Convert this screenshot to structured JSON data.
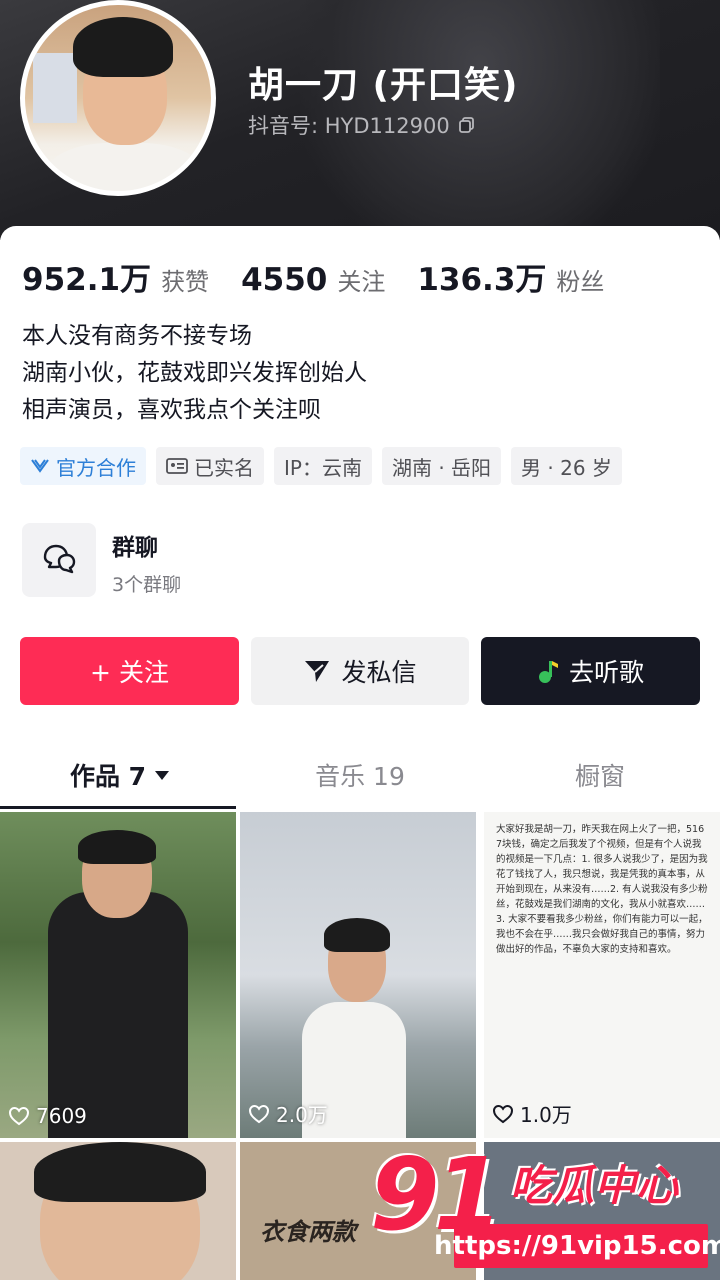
{
  "profile": {
    "nickname": "胡一刀 (开口笑)",
    "douyin_id": "抖音号: HYD112900"
  },
  "stats": [
    {
      "value": "952.1万",
      "label": "获赞"
    },
    {
      "value": "4550",
      "label": "关注"
    },
    {
      "value": "136.3万",
      "label": "粉丝"
    }
  ],
  "bio": [
    "本人没有商务不接专场",
    "湖南小伙，花鼓戏即兴发挥创始人",
    "相声演员，喜欢我点个关注呗"
  ],
  "tags": [
    {
      "label": "官方合作",
      "icon": "official-cooperation-icon"
    },
    {
      "label": "已实名",
      "icon": "id-card-icon"
    },
    {
      "label": "IP：云南"
    },
    {
      "label": "湖南 · 岳阳"
    },
    {
      "label": "男 · 26 岁"
    }
  ],
  "group": {
    "title": "群聊",
    "subtitle": "3个群聊"
  },
  "actions": {
    "follow": "+ 关注",
    "message": "发私信",
    "music": "去听歌"
  },
  "tabs": [
    {
      "label": "作品 7"
    },
    {
      "label": "音乐 19"
    },
    {
      "label": "橱窗"
    }
  ],
  "videos": [
    {
      "likes": "7609"
    },
    {
      "likes": "2.0万"
    },
    {
      "likes": "1.0万",
      "text": "大家好我是胡一刀，昨天我在网上火了一把，5167块钱，确定之后我发了个视频，但是有个人说我的视频是一下几点：1. 很多人说我少了，是因为我花了钱找了人，我只想说，我是凭我的真本事，从开始到现在，从来没有……2. 有人说我没有多少粉丝，花鼓戏是我们湖南的文化，我从小就喜欢……3. 大家不要看我多少粉丝，你们有能力可以一起，我也不会在乎……我只会做好我自己的事情，努力做出好的作品，不辜负大家的支持和喜欢。"
    },
    {
      "likes": ""
    },
    {
      "likes": "",
      "text": "衣食两款"
    },
    {
      "likes": ""
    }
  ],
  "watermark": {
    "logo": "91",
    "name": "吃瓜中心",
    "url": "https://91vip15.com"
  },
  "colors": {
    "accent": "#fe2c55",
    "dark_button": "#161823",
    "watermark": "#f4204a"
  }
}
